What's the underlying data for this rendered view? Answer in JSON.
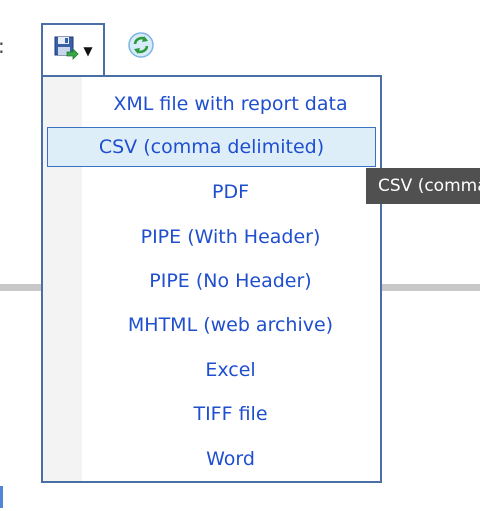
{
  "toolbar": {
    "export_icon": "save-export-icon",
    "dropdown_icon": "caret-down-icon",
    "refresh_icon": "refresh-icon"
  },
  "left_fragment": ":",
  "menu": {
    "items": [
      {
        "label": "XML file with report data"
      },
      {
        "label": "CSV (comma delimited)"
      },
      {
        "label": "PDF"
      },
      {
        "label": "PIPE (With Header)"
      },
      {
        "label": "PIPE (No Header)"
      },
      {
        "label": "MHTML (web archive)"
      },
      {
        "label": "Excel"
      },
      {
        "label": "TIFF file"
      },
      {
        "label": "Word"
      }
    ],
    "highlighted_index": 1
  },
  "tooltip": {
    "text": "CSV (comma delimited)"
  },
  "colors": {
    "menu_text": "#1f4fcf",
    "menu_border": "#4a6fa5",
    "highlight_bg": "#ddeef9",
    "tooltip_bg": "#505050"
  }
}
